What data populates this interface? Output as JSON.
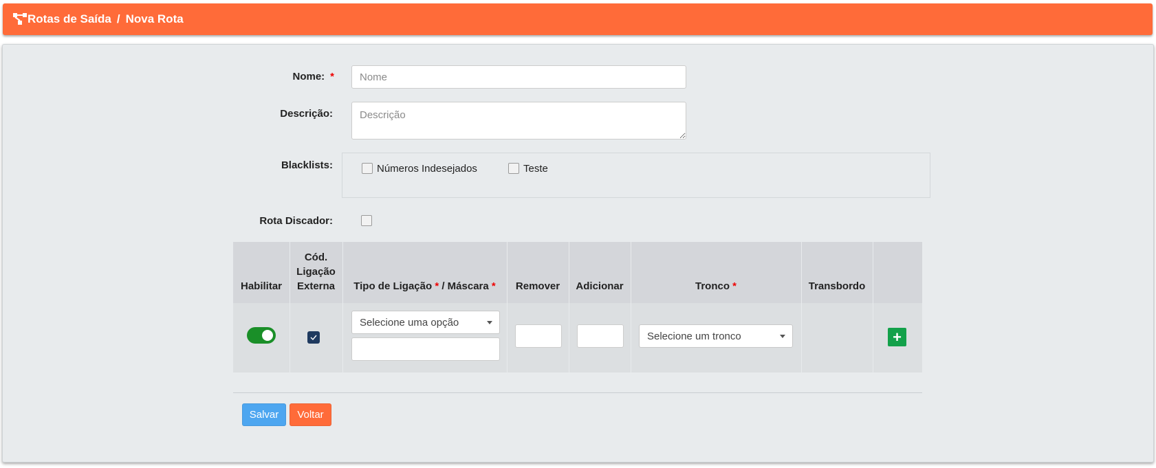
{
  "header": {
    "breadcrumb_root": "Rotas de Saída",
    "separator": "/",
    "breadcrumb_current": "Nova Rota",
    "icon": "sitemap-icon"
  },
  "form": {
    "nome": {
      "label": "Nome:",
      "required_mark": "*",
      "placeholder": "Nome",
      "value": ""
    },
    "descricao": {
      "label": "Descrição:",
      "placeholder": "Descrição",
      "value": ""
    },
    "blacklists": {
      "label": "Blacklists:",
      "options": [
        {
          "label": "Números Indesejados",
          "checked": false
        },
        {
          "label": "Teste",
          "checked": false
        }
      ]
    },
    "rota_discador": {
      "label": "Rota Discador:",
      "checked": false
    }
  },
  "table": {
    "headers": {
      "habilitar": "Habilitar",
      "cod_line1": "Cód.",
      "cod_line2": "Ligação",
      "cod_line3": "Externa",
      "tipo": "Tipo de Ligação",
      "tipo_sep": " / Máscara",
      "remover": "Remover",
      "adicionar": "Adicionar",
      "tronco": "Tronco",
      "transbordo": "Transbordo",
      "required_mark": "*"
    },
    "row": {
      "habilitar": true,
      "cod_externa": true,
      "tipo_select": "Selecione uma opção",
      "mascara": "",
      "remover": "",
      "adicionar": "",
      "tronco_select": "Selecione um tronco",
      "add_button": "+"
    }
  },
  "actions": {
    "save_label": "Salvar",
    "back_label": "Voltar"
  },
  "colors": {
    "header": "#ff6b39",
    "save": "#4da6f0",
    "back": "#ff6b39",
    "add": "#13a14a",
    "toggle_on": "#1a8f28",
    "checkbox_checked": "#1f3a5f",
    "required": "#ee0000"
  }
}
